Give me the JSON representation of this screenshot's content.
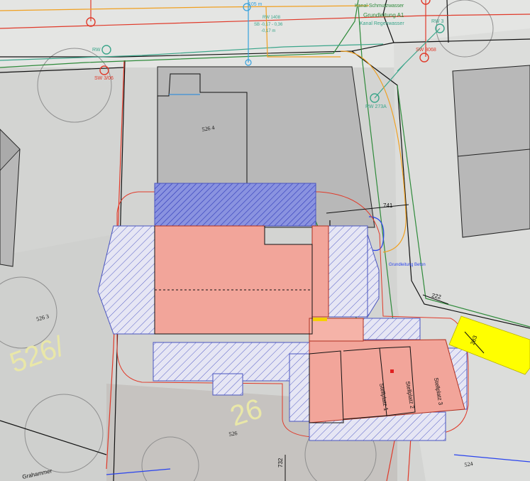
{
  "parcels": {
    "p526_4_top": "526\n4",
    "p526_3_left": "526\n3",
    "p526_4_bottom": "526",
    "p524": "524"
  },
  "annotations": {
    "rw_top_left": "RW",
    "sw_left": "SW 3/06",
    "sw_right": "SW 3068",
    "rw_right_top": "RW 3",
    "rw_273a": "RW 273A",
    "rw_right_mid": "RW 3",
    "kanal_header": "Kanal Schmutzwasser",
    "grundleitung_a1": "Grundleitung A1",
    "kanal_regen": "Kanal Regenwasser",
    "note_105": "105 m",
    "note_rw1408": "RW 1408",
    "note_sb": "SB  -0,17 - 0,36",
    "note_sb2": "-0,17 m",
    "grundleitung_beton": "Grundleitung Beton",
    "stellplatz_1": "Stellplatz 1",
    "stellplatz_2": "Stellplatz 2",
    "stellplatz_3": "Stellplatz 3",
    "graham_street": "Grahammer",
    "ghost_526": "526/",
    "ghost_26": "26"
  },
  "dimensions": {
    "d741": "741",
    "d222": "222",
    "d283": "283",
    "d732": "732"
  },
  "colors": {
    "existing_building": "#b8b8b8",
    "planned_building": "#f2a59a",
    "hatch_blue": "#5a63c8",
    "hatch_dark_blue": "#3c47c6",
    "boundary_red": "#e03a2a",
    "water_green": "#2e8a3a",
    "waste_teal": "#3aa58a",
    "gas_orange": "#f0a020",
    "yellow_zone": "#ffff00",
    "sewer_blue": "#2a44ee",
    "waterline_cyan": "#33a0dd"
  }
}
